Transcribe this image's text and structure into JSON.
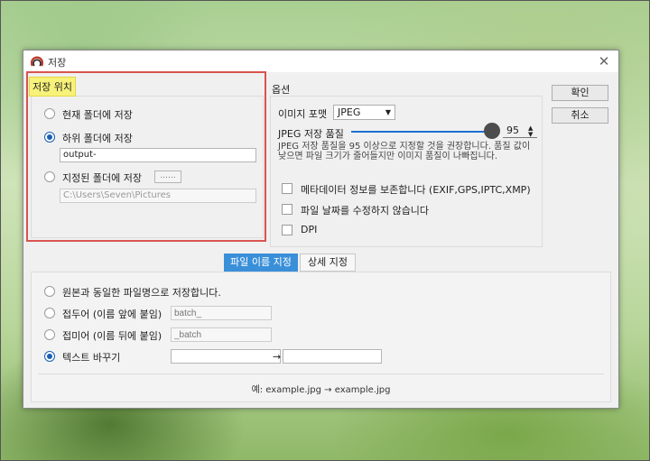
{
  "window": {
    "title": "저장"
  },
  "location": {
    "legend": "저장 위치",
    "options": [
      {
        "label": "현재 폴더에 저장",
        "selected": false
      },
      {
        "label": "하위 폴더에 저장",
        "selected": true
      },
      {
        "label": "지정된 폴더에 저장",
        "selected": false
      }
    ],
    "subfolder_value": "output-",
    "browse_label": "......",
    "folder_path": "C:\\Users\\Seven\\Pictures"
  },
  "options": {
    "legend": "옵션",
    "format_label": "이미지 포맷",
    "format_value": "JPEG",
    "quality_label": "JPEG 저장 품질",
    "quality_value": "95",
    "quality_fraction": 0.95,
    "quality_desc": "JPEG 저장 품질을 95 이상으로 지정할 것을 권장합니다. 품질 값이 낮으면 파일 크기가 줄어들지만 이미지 품질이 나빠집니다.",
    "checkboxes": [
      {
        "label": "메타데이터 정보를 보존합니다 (EXIF,GPS,IPTC,XMP)",
        "checked": false
      },
      {
        "label": "파일 날짜를 수정하지 않습니다",
        "checked": false
      },
      {
        "label": "DPI",
        "checked": false
      }
    ]
  },
  "buttons": {
    "ok": "확인",
    "cancel": "취소"
  },
  "tabs": [
    {
      "label": "파일 이름 지정",
      "active": true
    },
    {
      "label": "상세 지정",
      "active": false
    }
  ],
  "naming": {
    "options": [
      {
        "label": "원본과 동일한 파일명으로 저장합니다.",
        "selected": false
      },
      {
        "label": "접두어 (이름 앞에 붙임)",
        "selected": false,
        "placeholder": "batch_"
      },
      {
        "label": "접미어 (이름 뒤에 붙임)",
        "selected": false,
        "placeholder": "_batch"
      },
      {
        "label": "텍스트 바꾸기",
        "selected": true
      }
    ],
    "arrow": "→",
    "example": "예: example.jpg → example.jpg"
  },
  "colors": {
    "accent": "#1a5fb4",
    "tab_active": "#3a8fd9",
    "highlight_border": "#d9534f",
    "legend_highlight": "#f7f27a"
  }
}
